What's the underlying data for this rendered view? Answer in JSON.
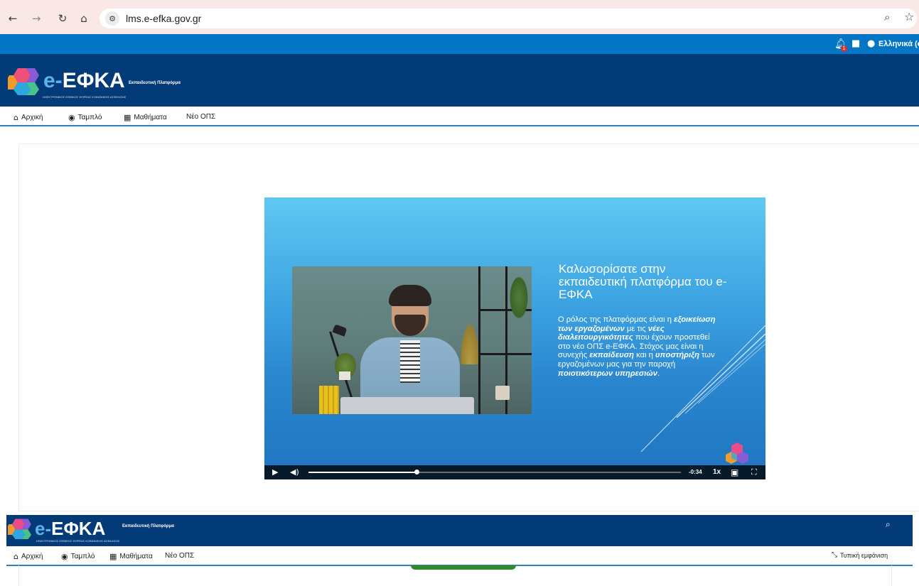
{
  "browser": {
    "url": "lms.e-efka.gov.gr"
  },
  "topbar": {
    "notifications_count": "1",
    "language": "Ελληνικά (el)"
  },
  "brand": {
    "logo_text_prefix": "e-",
    "logo_text_main": "ΕΦΚΑ",
    "logo_subtitle": "ΗΛΕΚΤΡΟΝΙΚΟΣ ΕΘΝΙΚΟΣ ΦΟΡΕΑΣ ΚΟΙΝΩΝΙΚΗΣ ΑΣΦΑΛΙΣΗΣ",
    "platform_label": "Εκπαιδευτική Πλατφόρμα"
  },
  "nav": {
    "items": [
      {
        "label": "Αρχική",
        "icon": "home-icon"
      },
      {
        "label": "Ταμπλό",
        "icon": "dashboard-icon"
      },
      {
        "label": "Μαθήματα",
        "icon": "grid-icon"
      },
      {
        "label": "Νέο ΟΠΣ",
        "icon": ""
      }
    ],
    "typical_view": "Τυπική εμφάνιση"
  },
  "video": {
    "slide_title": "Καλωσορίσατε στην εκπαιδευτική πλατφόρμα του e-ΕΦΚΑ",
    "body": {
      "p1": "Ο ρόλος της πλατφόρμας είναι η",
      "b1": "εξοικείωση των εργαζομένων",
      "p2": "με τις",
      "b2": "νέες διαλειτουργικότητες",
      "p3": "που έχουν προστεθεί στο νέο ΟΠΣ e-ΕΦΚΑ. Στόχος μας είναι η συνεχής",
      "b3": "εκπαίδευση",
      "p4": "και η",
      "b4": "υποστήριξη",
      "p5": "των εργαζομένων μας για την παροχή",
      "b5": "ποιοτικότερων υπηρεσιών",
      "p6": "."
    },
    "time_remaining": "-0:34",
    "speed": "1x",
    "progress": 0.29
  },
  "colors": {
    "browser_chrome": "#f9e8e6",
    "topbar": "#0576c6",
    "header": "#033a78",
    "nav_underline": "#2f7fbf"
  }
}
